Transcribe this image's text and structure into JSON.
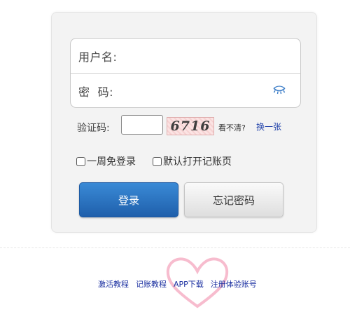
{
  "login_form": {
    "username_label": "用户名:",
    "username_value": "",
    "password_label": "密  码:",
    "password_value": "",
    "password_toggle_icon": "eye-closed-icon"
  },
  "captcha": {
    "label": "验证码:",
    "value": "",
    "code": "6716",
    "unclear_text": "看不清?",
    "refresh_link": "换一张"
  },
  "options": {
    "remember_week": "一周免登录",
    "default_open_ledger": "默认打开记账页"
  },
  "buttons": {
    "login": "登录",
    "forgot_password": "忘记密码"
  },
  "footer": {
    "links": [
      "激活教程",
      "记账教程",
      "APP下载",
      "注册体验账号"
    ]
  },
  "colors": {
    "login_button": "#2b74c4",
    "link": "#1a3ca8",
    "heart": "#f4a6bd"
  }
}
